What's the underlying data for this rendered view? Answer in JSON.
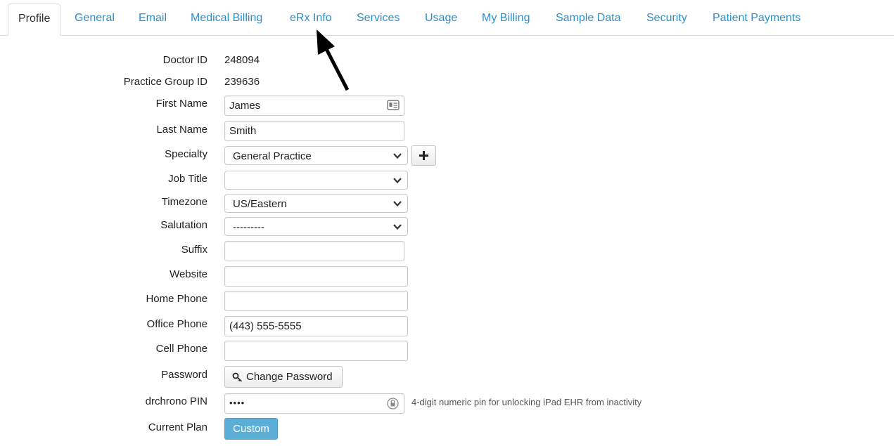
{
  "tabs": [
    {
      "label": "Profile",
      "active": true
    },
    {
      "label": "General"
    },
    {
      "label": "Email"
    },
    {
      "label": "Medical Billing"
    },
    {
      "label": "eRx Info"
    },
    {
      "label": "Services"
    },
    {
      "label": "Usage"
    },
    {
      "label": "My Billing"
    },
    {
      "label": "Sample Data"
    },
    {
      "label": "Security"
    },
    {
      "label": "Patient Payments"
    }
  ],
  "form": {
    "doctor_id": {
      "label": "Doctor ID",
      "value": "248094"
    },
    "practice_group_id": {
      "label": "Practice Group ID",
      "value": "239636"
    },
    "first_name": {
      "label": "First Name",
      "value": "James",
      "icon": "contact-card-icon"
    },
    "last_name": {
      "label": "Last Name",
      "value": "Smith"
    },
    "specialty": {
      "label": "Specialty",
      "value": "General Practice",
      "add_icon": "plus-icon"
    },
    "job_title": {
      "label": "Job Title",
      "value": ""
    },
    "timezone": {
      "label": "Timezone",
      "value": "US/Eastern"
    },
    "salutation": {
      "label": "Salutation",
      "value": "---------"
    },
    "suffix": {
      "label": "Suffix",
      "value": ""
    },
    "website": {
      "label": "Website",
      "value": ""
    },
    "home_phone": {
      "label": "Home Phone",
      "value": ""
    },
    "office_phone": {
      "label": "Office Phone",
      "value": "(443) 555-5555"
    },
    "cell_phone": {
      "label": "Cell Phone",
      "value": ""
    },
    "password": {
      "label": "Password",
      "button": "Change Password",
      "icon": "key-icon"
    },
    "pin": {
      "label": "drchrono PIN",
      "value": "••••",
      "icon": "lock-icon",
      "help": "4-digit numeric pin for unlocking iPad EHR from inactivity"
    },
    "current_plan": {
      "label": "Current Plan",
      "button": "Custom"
    }
  },
  "colors": {
    "tab_link": "#2f8ec9",
    "plan_button": "#5bafd6"
  }
}
